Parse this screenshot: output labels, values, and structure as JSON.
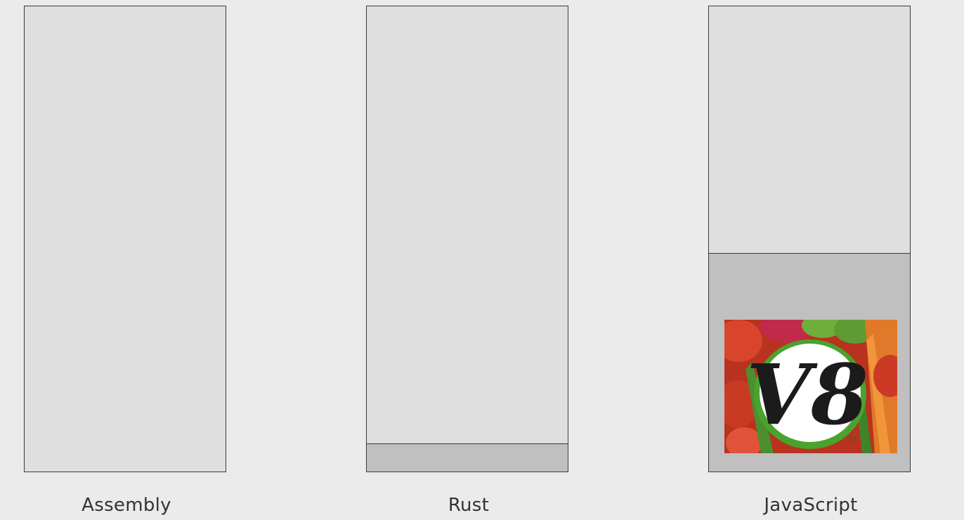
{
  "columns": [
    {
      "id": "assembly",
      "label": "Assembly",
      "fill_fraction": 0.0
    },
    {
      "id": "rust",
      "label": "Rust",
      "fill_fraction": 0.06
    },
    {
      "id": "javascript",
      "label": "JavaScript",
      "fill_fraction": 0.47,
      "logo": "v8-logo",
      "logo_text": "V8"
    }
  ],
  "colors": {
    "background": "#ebebeb",
    "column_empty": "#dfdfdf",
    "column_fill": "#c0c0c0",
    "border": "#3a3a3a"
  }
}
